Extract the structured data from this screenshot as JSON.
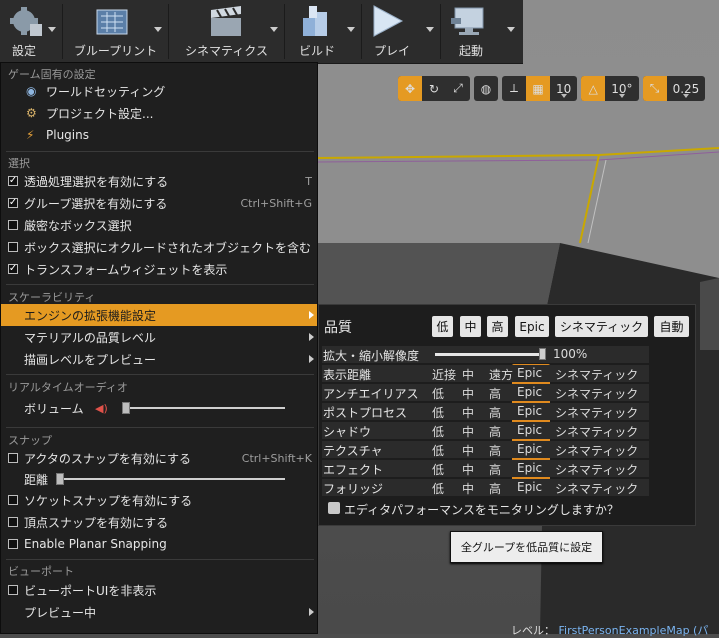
{
  "toolbar": {
    "buttons": [
      {
        "label": "設定",
        "icon": "gear-icon"
      },
      {
        "label": "ブループリント",
        "icon": "blueprint-icon"
      },
      {
        "label": "シネマティクス",
        "icon": "clapperboard-icon"
      },
      {
        "label": "ビルド",
        "icon": "build-blocks-icon"
      },
      {
        "label": "プレイ",
        "icon": "play-icon"
      },
      {
        "label": "起動",
        "icon": "launch-monitor-icon"
      }
    ]
  },
  "viewport_tools": {
    "grid_snap_value": "10",
    "rotation_snap_value": "10°",
    "scale_snap_value": "0.25"
  },
  "settings_menu": {
    "game_section": {
      "title": "ゲーム固有の設定",
      "world_settings": "ワールドセッティング",
      "project_settings": "プロジェクト設定...",
      "plugins": "Plugins"
    },
    "selection_section": {
      "title": "選択",
      "items": [
        {
          "label": "透過処理選択を有効にする",
          "checked": true,
          "shortcut": "T"
        },
        {
          "label": "グループ選択を有効にする",
          "checked": true,
          "shortcut": "Ctrl+Shift+G"
        },
        {
          "label": "厳密なボックス選択",
          "checked": false,
          "shortcut": ""
        },
        {
          "label": "ボックス選択にオクルードされたオブジェクトを含む",
          "checked": false,
          "shortcut": ""
        },
        {
          "label": "トランスフォームウィジェットを表示",
          "checked": true,
          "shortcut": ""
        }
      ]
    },
    "scalability_section": {
      "title": "スケーラビリティ",
      "engine_scalability": "エンジンの拡張機能設定",
      "material_quality": "マテリアルの品質レベル",
      "preview_rendering": "描画レベルをプレビュー"
    },
    "audio_section": {
      "title": "リアルタイムオーディオ",
      "volume_label": "ボリューム",
      "volume_level": 0.0
    },
    "snap_section": {
      "title": "スナップ",
      "actor_snap": {
        "label": "アクタのスナップを有効にする",
        "checked": false,
        "shortcut": "Ctrl+Shift+K"
      },
      "distance_label": "距離",
      "distance_level": 0.0,
      "socket_snap": {
        "label": "ソケットスナップを有効にする",
        "checked": false
      },
      "vertex_snap": {
        "label": "頂点スナップを有効にする",
        "checked": false
      },
      "planar_snap": {
        "label": "Enable Planar Snapping",
        "checked": false
      }
    },
    "viewport_section": {
      "title": "ビューポート",
      "hide_ui": {
        "label": "ビューポートUIを非表示",
        "checked": false
      },
      "previewing": "プレビュー中"
    }
  },
  "quality_panel": {
    "title": "品質",
    "presets": [
      "低",
      "中",
      "高",
      "Epic",
      "シネマティック",
      "自動"
    ],
    "resolution_label": "拡大・縮小解像度",
    "resolution_value": "100%",
    "resolution_level": 1.0,
    "levels": [
      "低",
      "中",
      "高",
      "Epic",
      "シネマティック"
    ],
    "view_distance_levels": [
      "近接",
      "中",
      "遠方",
      "Epic",
      "シネマティック"
    ],
    "rows": [
      {
        "label": "表示距離",
        "selected": "Epic"
      },
      {
        "label": "アンチエイリアス",
        "selected": "Epic"
      },
      {
        "label": "ポストプロセス",
        "selected": "Epic"
      },
      {
        "label": "シャドウ",
        "selected": "Epic"
      },
      {
        "label": "テクスチャ",
        "selected": "Epic"
      },
      {
        "label": "エフェクト",
        "selected": "Epic"
      },
      {
        "label": "フォリッジ",
        "selected": "Epic"
      }
    ],
    "monitor_label": "エディタパフォーマンスをモニタリングしますか？",
    "monitor_checked": false
  },
  "apply_button": "全グループを低品質に設定",
  "status": {
    "level_label": "レベル：",
    "map_name": "FirstPersonExampleMap (パ"
  },
  "colors": {
    "accent": "#e59a22",
    "epic_highlight": "#e08a1e",
    "menu_bg": "#1f1f1f"
  }
}
